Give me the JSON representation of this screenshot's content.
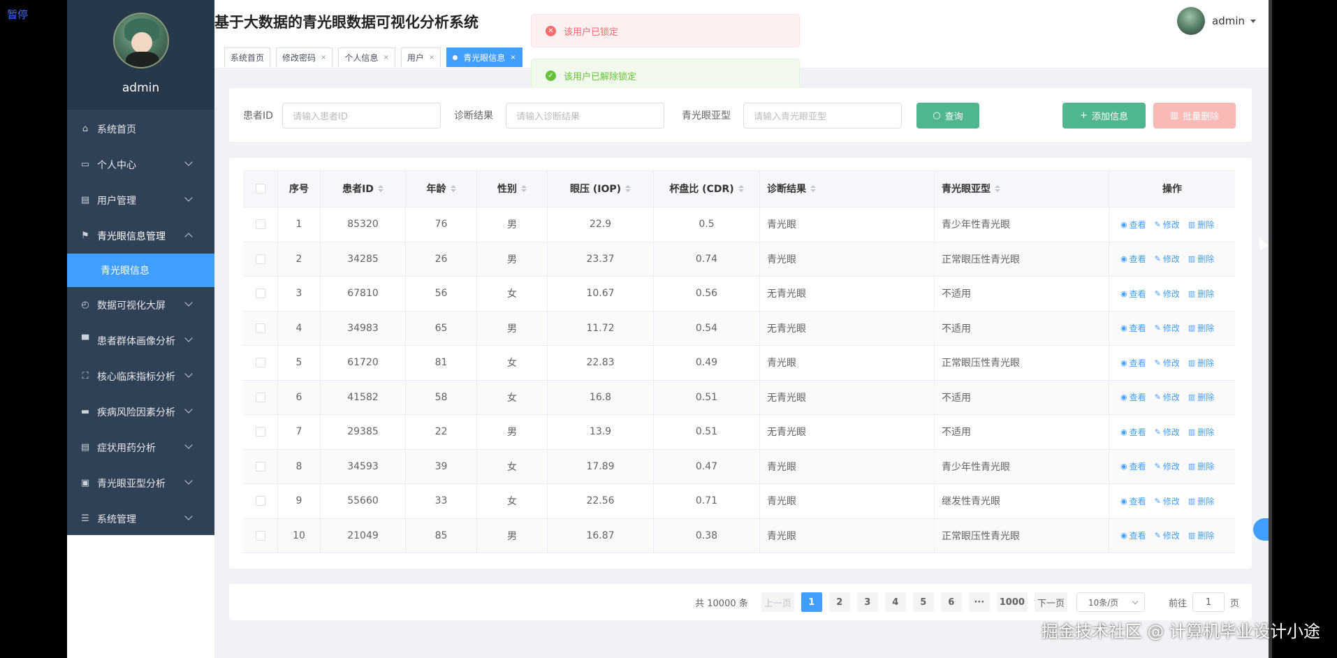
{
  "player": {
    "pause_label": "暂停"
  },
  "app_title": "基于大数据的青光眼数据可视化分析系统",
  "profile": {
    "name": "admin"
  },
  "sidebar": {
    "items": [
      {
        "label": "系统首页",
        "icon": "home-icon",
        "glyph": "⌂"
      },
      {
        "label": "个人中心",
        "icon": "card-icon",
        "glyph": "▭"
      },
      {
        "label": "用户管理",
        "icon": "clipboard-icon",
        "glyph": "▤"
      },
      {
        "label": "青光眼信息管理",
        "icon": "flag-icon",
        "glyph": "⚑"
      },
      {
        "label": "数据可视化大屏",
        "icon": "compass-icon",
        "glyph": "◴"
      },
      {
        "label": "患者群体画像分析",
        "icon": "brush-icon",
        "glyph": "▀"
      },
      {
        "label": "核心临床指标分析",
        "icon": "fullscreen-icon",
        "glyph": "⛶"
      },
      {
        "label": "疾病风险因素分析",
        "icon": "monitor-icon",
        "glyph": "▬"
      },
      {
        "label": "症状用药分析",
        "icon": "list-icon",
        "glyph": "▤"
      },
      {
        "label": "青光眼亚型分析",
        "icon": "checklist-icon",
        "glyph": "▣"
      },
      {
        "label": "系统管理",
        "icon": "menu-lines-icon",
        "glyph": "☰"
      }
    ],
    "submenu_label": "青光眼信息"
  },
  "tabs": [
    {
      "label": "系统首页",
      "closable": false
    },
    {
      "label": "修改密码",
      "closable": true
    },
    {
      "label": "个人信息",
      "closable": true
    },
    {
      "label": "用户",
      "closable": true
    },
    {
      "label": "青光眼信息",
      "closable": true,
      "active": true
    }
  ],
  "user": {
    "name": "admin"
  },
  "toasts": {
    "error": "该用户已锁定",
    "success": "该用户已解除锁定"
  },
  "search": {
    "patient_id_label": "患者ID",
    "patient_id_placeholder": "请输入患者ID",
    "diagnosis_label": "诊断结果",
    "diagnosis_placeholder": "请输入诊断结果",
    "subtype_label": "青光眼亚型",
    "subtype_placeholder": "请输入青光眼亚型",
    "query_label": "查询",
    "add_label": "添加信息",
    "batch_delete_label": "批量删除"
  },
  "table": {
    "headers": {
      "index": "序号",
      "patient_id": "患者ID",
      "age": "年龄",
      "gender": "性别",
      "iop": "眼压 (IOP)",
      "cdr": "杯盘比 (CDR)",
      "diagnosis": "诊断结果",
      "subtype": "青光眼亚型",
      "actions": "操作"
    },
    "actions": {
      "view": "查看",
      "edit": "修改",
      "delete": "删除"
    },
    "rows": [
      {
        "index": "1",
        "patient_id": "85320",
        "age": "76",
        "gender": "男",
        "iop": "22.9",
        "cdr": "0.5",
        "diagnosis": "青光眼",
        "subtype": "青少年性青光眼"
      },
      {
        "index": "2",
        "patient_id": "34285",
        "age": "26",
        "gender": "男",
        "iop": "23.37",
        "cdr": "0.74",
        "diagnosis": "青光眼",
        "subtype": "正常眼压性青光眼"
      },
      {
        "index": "3",
        "patient_id": "67810",
        "age": "56",
        "gender": "女",
        "iop": "10.67",
        "cdr": "0.56",
        "diagnosis": "无青光眼",
        "subtype": "不适用"
      },
      {
        "index": "4",
        "patient_id": "34983",
        "age": "65",
        "gender": "男",
        "iop": "11.72",
        "cdr": "0.54",
        "diagnosis": "无青光眼",
        "subtype": "不适用"
      },
      {
        "index": "5",
        "patient_id": "61720",
        "age": "81",
        "gender": "女",
        "iop": "22.83",
        "cdr": "0.49",
        "diagnosis": "青光眼",
        "subtype": "正常眼压性青光眼"
      },
      {
        "index": "6",
        "patient_id": "41582",
        "age": "58",
        "gender": "女",
        "iop": "16.8",
        "cdr": "0.51",
        "diagnosis": "无青光眼",
        "subtype": "不适用"
      },
      {
        "index": "7",
        "patient_id": "29385",
        "age": "22",
        "gender": "男",
        "iop": "13.9",
        "cdr": "0.51",
        "diagnosis": "无青光眼",
        "subtype": "不适用"
      },
      {
        "index": "8",
        "patient_id": "34593",
        "age": "39",
        "gender": "女",
        "iop": "17.89",
        "cdr": "0.47",
        "diagnosis": "青光眼",
        "subtype": "青少年性青光眼"
      },
      {
        "index": "9",
        "patient_id": "55660",
        "age": "33",
        "gender": "女",
        "iop": "22.56",
        "cdr": "0.71",
        "diagnosis": "青光眼",
        "subtype": "继发性青光眼"
      },
      {
        "index": "10",
        "patient_id": "21049",
        "age": "85",
        "gender": "男",
        "iop": "16.87",
        "cdr": "0.38",
        "diagnosis": "青光眼",
        "subtype": "正常眼压性青光眼"
      }
    ]
  },
  "pagination": {
    "total_label": "共 10000 条",
    "prev_label": "上一页",
    "next_label": "下一页",
    "pages": [
      "1",
      "2",
      "3",
      "4",
      "5",
      "6",
      "···",
      "1000"
    ],
    "current_page": "1",
    "page_size_label": "10条/页",
    "goto_prefix": "前往",
    "goto_value": "1",
    "goto_suffix": "页"
  },
  "watermark": "掘金技术社区 @ 计算机毕业设计小途",
  "colors": {
    "sidebar_bg": "#304156",
    "primary": "#409eff",
    "success_button": "#50b68e",
    "danger_button_disabled": "#f9b9b6"
  }
}
